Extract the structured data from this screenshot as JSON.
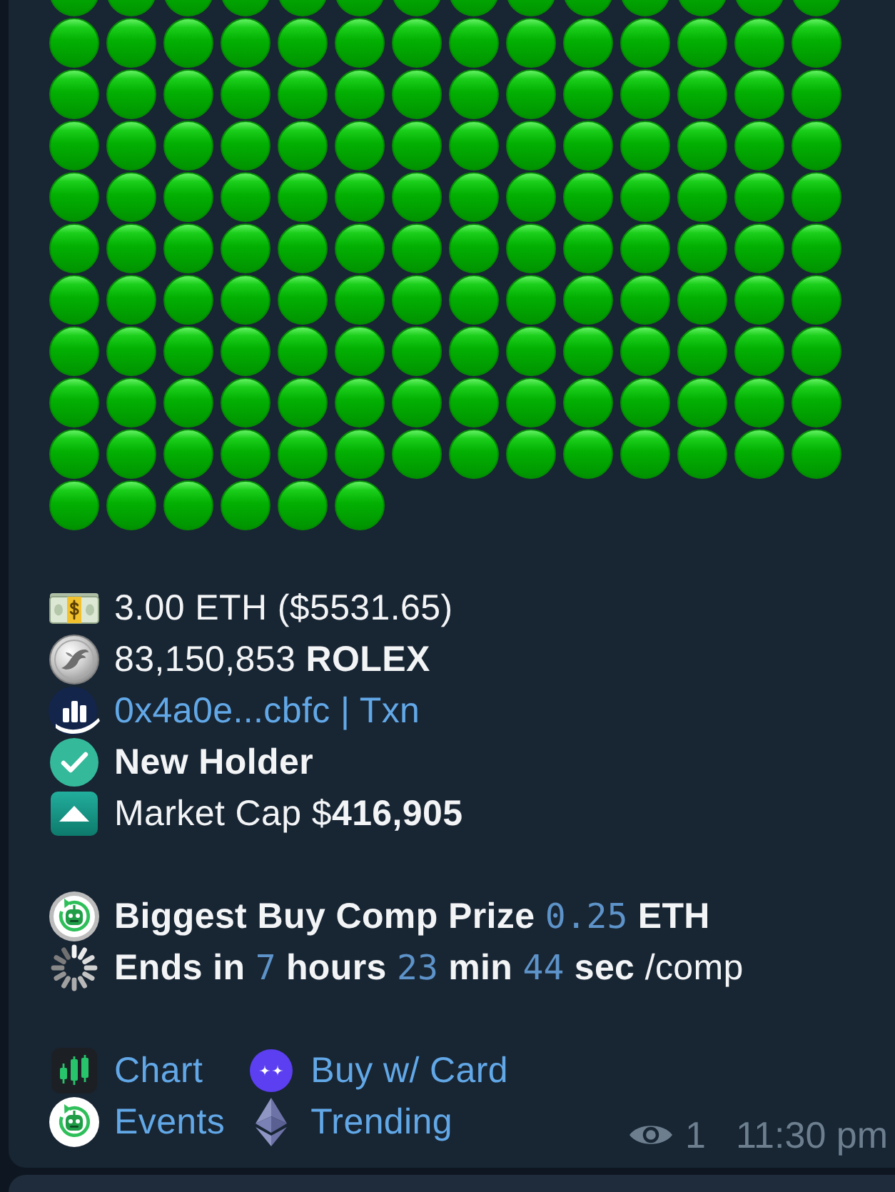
{
  "message": {
    "emoji_bar": [
      {
        "kind": "green_circle"
      },
      {
        "kind": "green_circle"
      },
      {
        "kind": "green_circle"
      },
      {
        "kind": "green_circle"
      },
      {
        "kind": "green_circle"
      },
      {
        "kind": "green_circle"
      },
      {
        "kind": "green_circle"
      },
      {
        "kind": "green_circle"
      },
      {
        "kind": "green_circle"
      },
      {
        "kind": "green_circle"
      },
      {
        "kind": "green_circle"
      },
      {
        "kind": "green_circle"
      },
      {
        "kind": "green_circle"
      },
      {
        "kind": "green_circle"
      },
      {
        "kind": "green_circle"
      },
      {
        "kind": "green_circle"
      },
      {
        "kind": "green_circle"
      },
      {
        "kind": "green_circle"
      },
      {
        "kind": "green_circle"
      },
      {
        "kind": "green_circle"
      },
      {
        "kind": "green_circle"
      },
      {
        "kind": "green_circle"
      },
      {
        "kind": "green_circle"
      },
      {
        "kind": "green_circle"
      },
      {
        "kind": "green_circle"
      },
      {
        "kind": "green_circle"
      },
      {
        "kind": "green_circle"
      },
      {
        "kind": "green_circle"
      },
      {
        "kind": "green_circle"
      },
      {
        "kind": "green_circle"
      },
      {
        "kind": "green_circle"
      },
      {
        "kind": "green_circle"
      },
      {
        "kind": "green_circle"
      },
      {
        "kind": "green_circle"
      },
      {
        "kind": "green_circle"
      },
      {
        "kind": "green_circle"
      },
      {
        "kind": "green_circle"
      },
      {
        "kind": "green_circle"
      },
      {
        "kind": "green_circle"
      },
      {
        "kind": "green_circle"
      },
      {
        "kind": "green_circle"
      },
      {
        "kind": "green_circle"
      },
      {
        "kind": "green_circle"
      },
      {
        "kind": "green_circle"
      },
      {
        "kind": "green_circle"
      },
      {
        "kind": "green_circle"
      },
      {
        "kind": "green_circle"
      },
      {
        "kind": "green_circle"
      },
      {
        "kind": "green_circle"
      },
      {
        "kind": "green_circle"
      },
      {
        "kind": "green_circle"
      },
      {
        "kind": "green_circle"
      },
      {
        "kind": "green_circle"
      },
      {
        "kind": "green_circle"
      },
      {
        "kind": "green_circle"
      },
      {
        "kind": "green_circle"
      },
      {
        "kind": "green_circle"
      },
      {
        "kind": "green_circle"
      },
      {
        "kind": "green_circle"
      },
      {
        "kind": "green_circle"
      },
      {
        "kind": "green_circle"
      },
      {
        "kind": "green_circle"
      },
      {
        "kind": "green_circle"
      },
      {
        "kind": "green_circle"
      },
      {
        "kind": "green_circle"
      },
      {
        "kind": "green_circle"
      },
      {
        "kind": "green_circle"
      },
      {
        "kind": "green_circle"
      },
      {
        "kind": "green_circle"
      },
      {
        "kind": "green_circle"
      },
      {
        "kind": "green_circle"
      },
      {
        "kind": "green_circle"
      },
      {
        "kind": "green_circle"
      },
      {
        "kind": "green_circle"
      },
      {
        "kind": "green_circle"
      },
      {
        "kind": "green_circle"
      },
      {
        "kind": "green_circle"
      },
      {
        "kind": "green_circle"
      },
      {
        "kind": "green_circle"
      },
      {
        "kind": "green_circle"
      },
      {
        "kind": "green_circle"
      },
      {
        "kind": "green_circle"
      },
      {
        "kind": "green_circle"
      },
      {
        "kind": "green_circle"
      },
      {
        "kind": "green_circle"
      },
      {
        "kind": "green_circle"
      },
      {
        "kind": "green_circle"
      },
      {
        "kind": "green_circle"
      },
      {
        "kind": "green_circle"
      },
      {
        "kind": "green_circle"
      },
      {
        "kind": "green_circle"
      },
      {
        "kind": "green_circle"
      },
      {
        "kind": "green_circle"
      },
      {
        "kind": "green_circle"
      },
      {
        "kind": "green_circle"
      },
      {
        "kind": "green_circle"
      },
      {
        "kind": "green_circle"
      },
      {
        "kind": "green_circle"
      },
      {
        "kind": "green_circle"
      },
      {
        "kind": "green_circle"
      },
      {
        "kind": "green_circle"
      },
      {
        "kind": "green_circle"
      },
      {
        "kind": "green_circle"
      },
      {
        "kind": "green_circle"
      },
      {
        "kind": "green_circle"
      },
      {
        "kind": "green_circle"
      },
      {
        "kind": "green_circle"
      },
      {
        "kind": "green_circle"
      },
      {
        "kind": "green_circle"
      },
      {
        "kind": "green_circle"
      },
      {
        "kind": "green_circle"
      },
      {
        "kind": "green_circle"
      },
      {
        "kind": "green_circle"
      },
      {
        "kind": "green_circle"
      },
      {
        "kind": "green_circle"
      },
      {
        "kind": "green_circle"
      },
      {
        "kind": "green_circle"
      },
      {
        "kind": "green_circle"
      },
      {
        "kind": "green_circle"
      },
      {
        "kind": "green_circle"
      },
      {
        "kind": "green_circle"
      },
      {
        "kind": "green_circle"
      },
      {
        "kind": "green_circle"
      },
      {
        "kind": "green_circle"
      },
      {
        "kind": "green_circle"
      },
      {
        "kind": "green_circle"
      },
      {
        "kind": "green_circle"
      },
      {
        "kind": "green_circle"
      },
      {
        "kind": "green_circle"
      },
      {
        "kind": "green_circle"
      },
      {
        "kind": "green_circle"
      },
      {
        "kind": "green_circle"
      },
      {
        "kind": "green_circle"
      },
      {
        "kind": "green_circle"
      },
      {
        "kind": "green_circle"
      },
      {
        "kind": "green_circle"
      },
      {
        "kind": "green_circle"
      },
      {
        "kind": "green_circle"
      },
      {
        "kind": "green_circle"
      },
      {
        "kind": "green_circle"
      },
      {
        "kind": "green_circle"
      },
      {
        "kind": "green_circle"
      },
      {
        "kind": "green_circle"
      },
      {
        "kind": "green_circle"
      },
      {
        "kind": "green_circle"
      },
      {
        "kind": "green_circle"
      }
    ],
    "buy_details": [
      {
        "kind": "buy_amount",
        "parts": [
          {
            "kind": "regular",
            "text": "3.00 ETH ($5531.65)"
          }
        ]
      },
      {
        "kind": "token_amount",
        "parts": [
          {
            "kind": "regular",
            "text": "83,150,853 "
          },
          {
            "kind": "bold",
            "text": "ROLEX"
          }
        ]
      },
      {
        "kind": "buyer",
        "parts": [
          {
            "kind": "link",
            "text": "0x4a0e...cbfc"
          },
          {
            "kind": "separator",
            "text": " | "
          },
          {
            "kind": "link",
            "text": "Txn"
          }
        ]
      },
      {
        "kind": "holder_status",
        "parts": [
          {
            "kind": "bold",
            "text": "New Holder"
          }
        ]
      },
      {
        "kind": "market_cap",
        "parts": [
          {
            "kind": "regular",
            "text": "Market Cap $"
          },
          {
            "kind": "bold",
            "text": "416,905"
          }
        ]
      }
    ],
    "competition": [
      {
        "kind": "prize",
        "parts": [
          {
            "kind": "bold",
            "text": "Biggest Buy Comp Prize "
          },
          {
            "kind": "code",
            "text": "0.25"
          },
          {
            "kind": "bold",
            "text": " ETH"
          }
        ]
      },
      {
        "kind": "countdown",
        "parts": [
          {
            "kind": "bold",
            "text": "Ends in "
          },
          {
            "kind": "code",
            "text": "7"
          },
          {
            "kind": "bold",
            "text": " hours "
          },
          {
            "kind": "code",
            "text": "23"
          },
          {
            "kind": "bold",
            "text": " min "
          },
          {
            "kind": "code",
            "text": "44"
          },
          {
            "kind": "bold",
            "text": " sec "
          },
          {
            "kind": "regular",
            "text": "/comp"
          }
        ]
      }
    ],
    "links": [
      {
        "kind": "chart",
        "label": "Chart"
      },
      {
        "kind": "buy_card",
        "label": "Buy w/ Card"
      },
      {
        "kind": "events",
        "label": "Events"
      },
      {
        "kind": "trending",
        "label": "Trending"
      }
    ],
    "views": "1",
    "time": "11:30 pm"
  }
}
